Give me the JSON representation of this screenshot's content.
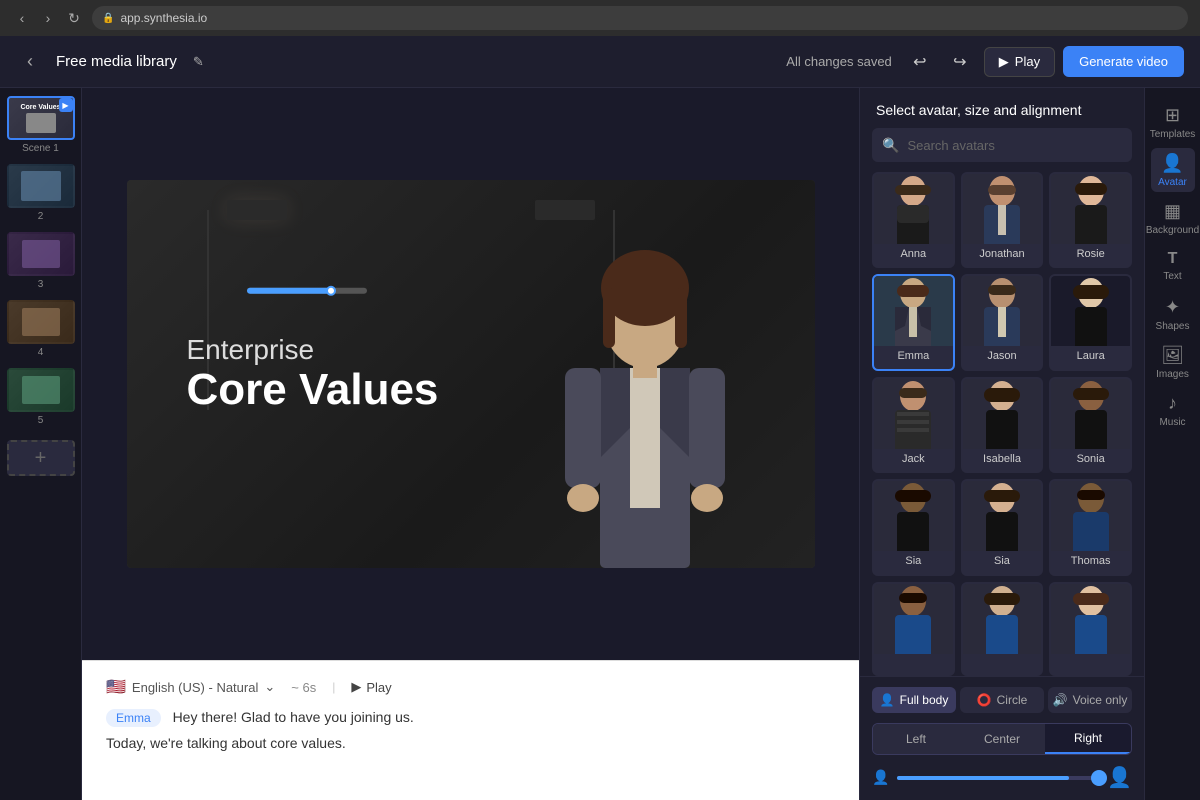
{
  "browser": {
    "url": "app.synthesia.io"
  },
  "header": {
    "back_label": "‹",
    "title": "Free media library",
    "edit_icon": "✎",
    "saved_status": "All changes saved",
    "undo_icon": "↩",
    "redo_icon": "↪",
    "play_label": "Play",
    "generate_label": "Generate video"
  },
  "scenes": [
    {
      "id": 1,
      "label": "Scene 1",
      "active": true,
      "has_badge": true
    },
    {
      "id": 2,
      "label": "2",
      "active": false
    },
    {
      "id": 3,
      "label": "3",
      "active": false
    },
    {
      "id": 4,
      "label": "4",
      "active": false
    },
    {
      "id": 5,
      "label": "5",
      "active": false
    }
  ],
  "canvas": {
    "subtitle": "Enterprise",
    "title": "Core Values"
  },
  "script": {
    "language": "English (US) - Natural",
    "duration": "~ 6s",
    "play_label": "Play",
    "speaker": "Emma",
    "lines": [
      "Hey there! Glad to have you joining us.",
      "Today, we're talking about core values."
    ]
  },
  "avatar_panel": {
    "header": "Select avatar, size and alignment",
    "search_placeholder": "Search avatars",
    "avatars": [
      {
        "name": "Anna",
        "skin": "light",
        "hair": "dark",
        "outfit": "dark",
        "selected": false
      },
      {
        "name": "Jonathan",
        "skin": "med",
        "hair": "med",
        "outfit": "suit",
        "selected": false
      },
      {
        "name": "Rosie",
        "skin": "light",
        "hair": "dark",
        "outfit": "dark",
        "selected": false
      },
      {
        "name": "Emma",
        "skin": "med",
        "hair": "dark",
        "outfit": "dark",
        "selected": true
      },
      {
        "name": "Jason",
        "skin": "med",
        "hair": "dark",
        "outfit": "suit",
        "selected": false
      },
      {
        "name": "Laura",
        "skin": "light",
        "hair": "dark",
        "outfit": "dark",
        "selected": false
      },
      {
        "name": "Jack",
        "skin": "med",
        "hair": "dark",
        "outfit": "stripe",
        "selected": false
      },
      {
        "name": "Isabella",
        "skin": "light",
        "hair": "dark",
        "outfit": "dark",
        "selected": false
      },
      {
        "name": "Sonia",
        "skin": "dark",
        "hair": "dark",
        "outfit": "dark",
        "selected": false
      },
      {
        "name": "Sia",
        "skin": "dark",
        "hair": "dark",
        "outfit": "dark",
        "selected": false
      },
      {
        "name": "Sia",
        "skin": "light",
        "hair": "dark",
        "outfit": "dark",
        "selected": false
      },
      {
        "name": "Thomas",
        "skin": "dark",
        "hair": "dark",
        "outfit": "blue",
        "selected": false
      },
      {
        "name": "",
        "skin": "dark",
        "hair": "dark",
        "outfit": "blue",
        "selected": false
      },
      {
        "name": "",
        "skin": "light",
        "hair": "dark",
        "outfit": "blue",
        "selected": false
      },
      {
        "name": "",
        "skin": "light",
        "hair": "dark",
        "outfit": "blue",
        "selected": false
      }
    ],
    "size_tabs": [
      {
        "label": "Full body",
        "icon": "👤",
        "active": true
      },
      {
        "label": "Circle",
        "icon": "⭕",
        "active": false
      },
      {
        "label": "Voice only",
        "icon": "🔊",
        "active": false
      }
    ],
    "align_tabs": [
      {
        "label": "Left",
        "active": false
      },
      {
        "label": "Center",
        "active": false
      },
      {
        "label": "Right",
        "active": true
      }
    ],
    "slider_value": 85
  },
  "right_sidebar": {
    "items": [
      {
        "icon": "⊞",
        "label": "Templates"
      },
      {
        "icon": "👤",
        "label": "Avatar"
      },
      {
        "icon": "▦",
        "label": "Background"
      },
      {
        "icon": "T",
        "label": "Text"
      },
      {
        "icon": "✦",
        "label": "Shapes"
      },
      {
        "icon": "🖼",
        "label": "Images"
      },
      {
        "icon": "♪",
        "label": "Music"
      }
    ]
  }
}
